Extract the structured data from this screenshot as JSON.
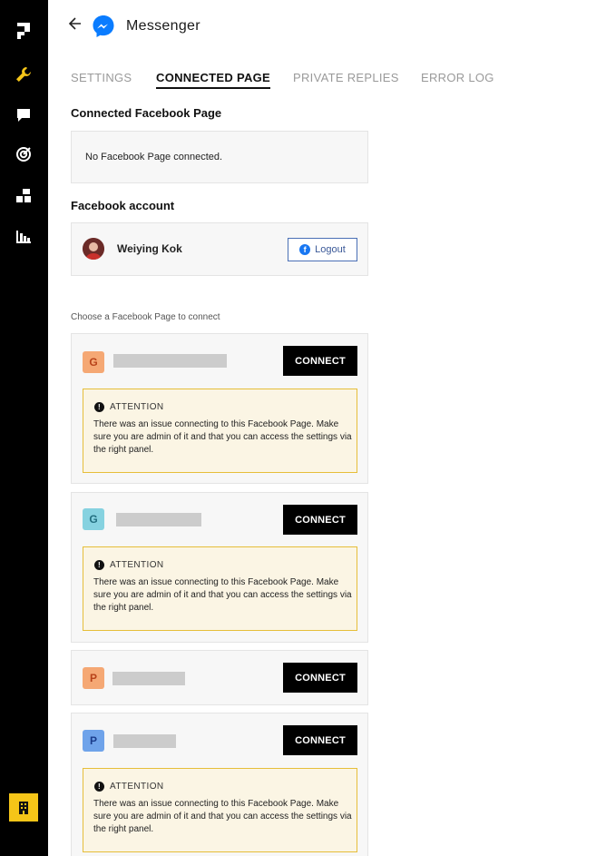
{
  "header": {
    "title": "Messenger"
  },
  "tabs": [
    {
      "label": "SETTINGS"
    },
    {
      "label": "CONNECTED PAGE"
    },
    {
      "label": "PRIVATE REPLIES"
    },
    {
      "label": "ERROR LOG"
    }
  ],
  "active_tab": "CONNECTED PAGE",
  "connected_page": {
    "title": "Connected Facebook Page",
    "status": "No Facebook Page connected."
  },
  "facebook_account": {
    "title": "Facebook account",
    "name": "Weiying Kok",
    "logout_label": "Logout"
  },
  "choose_label": "Choose a Facebook Page to connect",
  "pages": [
    {
      "initial": "G",
      "badge_bg": "#f5a874",
      "badge_fg": "#b8431a",
      "connect_label": "CONNECT",
      "has_attention": true
    },
    {
      "initial": "G",
      "badge_bg": "#86d2e0",
      "badge_fg": "#236f80",
      "connect_label": "CONNECT",
      "has_attention": true
    },
    {
      "initial": "P",
      "badge_bg": "#f5a874",
      "badge_fg": "#b8431a",
      "connect_label": "CONNECT",
      "has_attention": false
    },
    {
      "initial": "P",
      "badge_bg": "#6fa3ea",
      "badge_fg": "#1b3d8c",
      "connect_label": "CONNECT",
      "has_attention": true
    }
  ],
  "attention": {
    "title": "ATTENTION",
    "text": "There was an issue connecting to this Facebook Page. Make sure you are admin of it and that you can access the settings via the right panel."
  },
  "sidebar": {
    "icons": [
      "logo-icon",
      "wrench-icon",
      "chat-icon",
      "target-icon",
      "blocks-icon",
      "bar-chart-icon",
      "building-icon"
    ]
  },
  "colors": {
    "accent": "#f5c518",
    "sidebar_bg": "#000000",
    "attention_bg": "#fbf5e4",
    "attention_border": "#e6be3a"
  }
}
